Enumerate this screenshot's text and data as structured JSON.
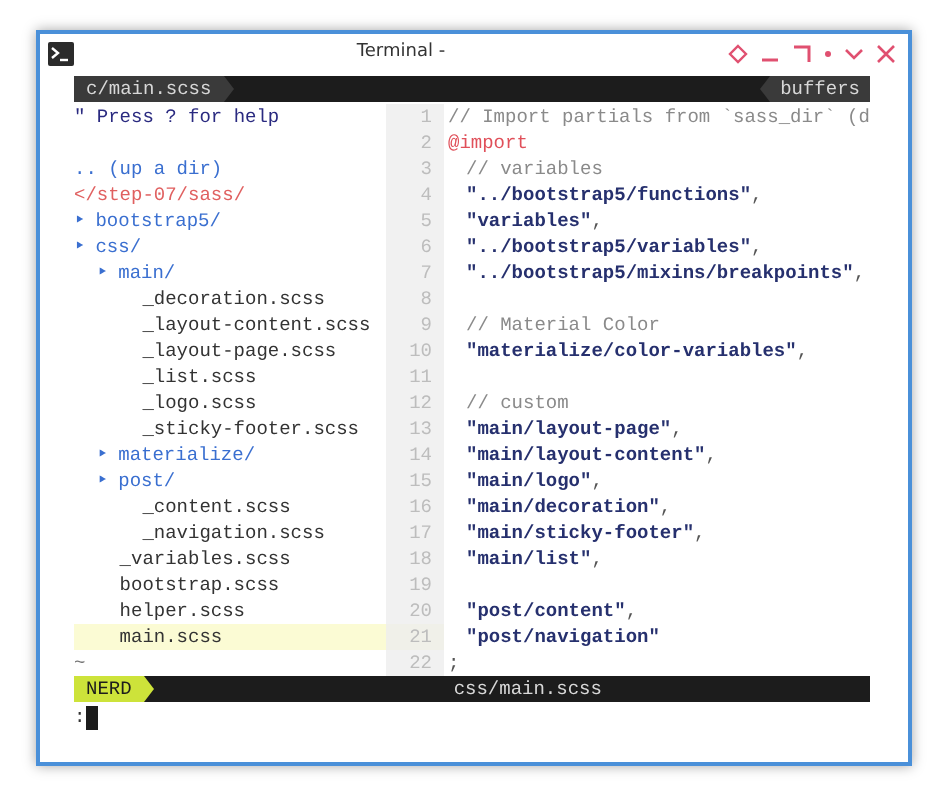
{
  "window": {
    "title": "Terminal -"
  },
  "tabline": {
    "buffer": "c/main.scss",
    "label": "buffers"
  },
  "tree": [
    {
      "kind": "help",
      "text": "\" Press ? for help"
    },
    {
      "kind": "blank"
    },
    {
      "kind": "updir",
      "text": ".. (up a dir)"
    },
    {
      "kind": "root",
      "text": "</step-07/sass/"
    },
    {
      "kind": "dir",
      "marker": "‣",
      "text": "bootstrap5/"
    },
    {
      "kind": "dir",
      "marker": "‣",
      "text": "css/",
      "children": [
        {
          "kind": "dir",
          "marker": "‣",
          "text": "main/",
          "children": [
            {
              "kind": "file",
              "text": "_decoration.scss",
              "selected": false
            },
            {
              "kind": "file",
              "text": "_layout-content.scss",
              "selected": false
            },
            {
              "kind": "file",
              "text": "_layout-page.scss",
              "selected": false
            },
            {
              "kind": "file",
              "text": "_list.scss",
              "selected": false
            },
            {
              "kind": "file",
              "text": "_logo.scss",
              "selected": false
            },
            {
              "kind": "file",
              "text": "_sticky-footer.scss",
              "selected": false
            }
          ]
        },
        {
          "kind": "dir",
          "marker": "‣",
          "text": "materialize/"
        },
        {
          "kind": "dir",
          "marker": "‣",
          "text": "post/",
          "children": [
            {
              "kind": "file",
              "text": "_content.scss",
              "selected": false
            },
            {
              "kind": "file",
              "text": "_navigation.scss",
              "selected": false
            }
          ]
        },
        {
          "kind": "file",
          "text": "_variables.scss",
          "selected": false
        },
        {
          "kind": "file",
          "text": "bootstrap.scss",
          "selected": false
        },
        {
          "kind": "file",
          "text": "helper.scss",
          "selected": false
        },
        {
          "kind": "file",
          "text": "main.scss",
          "selected": true
        }
      ]
    },
    {
      "kind": "end",
      "text": "~"
    }
  ],
  "code": [
    {
      "number": "1",
      "indented": false,
      "tokens": [
        {
          "kind": "comment",
          "text": "// Import partials from `sass_dir` (d"
        }
      ]
    },
    {
      "number": "2",
      "indented": false,
      "tokens": [
        {
          "kind": "keyword",
          "text": "@import"
        }
      ]
    },
    {
      "number": "3",
      "indented": true,
      "tokens": [
        {
          "kind": "comment",
          "text": "// variables"
        }
      ]
    },
    {
      "number": "4",
      "indented": true,
      "tokens": [
        {
          "kind": "string",
          "text": "\"../bootstrap5/functions\""
        },
        {
          "kind": "punct",
          "text": ","
        }
      ]
    },
    {
      "number": "5",
      "indented": true,
      "tokens": [
        {
          "kind": "string",
          "text": "\"variables\""
        },
        {
          "kind": "punct",
          "text": ","
        }
      ]
    },
    {
      "number": "6",
      "indented": true,
      "tokens": [
        {
          "kind": "string",
          "text": "\"../bootstrap5/variables\""
        },
        {
          "kind": "punct",
          "text": ","
        }
      ]
    },
    {
      "number": "7",
      "indented": true,
      "tokens": [
        {
          "kind": "string",
          "text": "\"../bootstrap5/mixins/breakpoints\""
        },
        {
          "kind": "punct",
          "text": ","
        }
      ]
    },
    {
      "number": "8",
      "indented": false
    },
    {
      "number": "9",
      "indented": true,
      "tokens": [
        {
          "kind": "comment",
          "text": "// Material Color"
        }
      ]
    },
    {
      "number": "10",
      "indented": true,
      "tokens": [
        {
          "kind": "string",
          "text": "\"materialize/color-variables\""
        },
        {
          "kind": "punct",
          "text": ","
        }
      ]
    },
    {
      "number": "11",
      "indented": false
    },
    {
      "number": "12",
      "indented": true,
      "tokens": [
        {
          "kind": "comment",
          "text": "// custom"
        }
      ]
    },
    {
      "number": "13",
      "indented": true,
      "tokens": [
        {
          "kind": "string",
          "text": "\"main/layout-page\""
        },
        {
          "kind": "punct",
          "text": ","
        }
      ]
    },
    {
      "number": "14",
      "indented": true,
      "tokens": [
        {
          "kind": "string",
          "text": "\"main/layout-content\""
        },
        {
          "kind": "punct",
          "text": ","
        }
      ]
    },
    {
      "number": "15",
      "indented": true,
      "tokens": [
        {
          "kind": "string",
          "text": "\"main/logo\""
        },
        {
          "kind": "punct",
          "text": ","
        }
      ]
    },
    {
      "number": "16",
      "indented": true,
      "tokens": [
        {
          "kind": "string",
          "text": "\"main/decoration\""
        },
        {
          "kind": "punct",
          "text": ","
        }
      ]
    },
    {
      "number": "17",
      "indented": true,
      "tokens": [
        {
          "kind": "string",
          "text": "\"main/sticky-footer\""
        },
        {
          "kind": "punct",
          "text": ","
        }
      ]
    },
    {
      "number": "18",
      "indented": true,
      "tokens": [
        {
          "kind": "string",
          "text": "\"main/list\""
        },
        {
          "kind": "punct",
          "text": ","
        }
      ]
    },
    {
      "number": "19",
      "indented": false
    },
    {
      "number": "20",
      "indented": true,
      "tokens": [
        {
          "kind": "string",
          "text": "\"post/content\""
        },
        {
          "kind": "punct",
          "text": ","
        }
      ]
    },
    {
      "number": "21",
      "indented": true,
      "tokens": [
        {
          "kind": "string",
          "text": "\"post/navigation\""
        }
      ]
    },
    {
      "number": "22",
      "indented": false,
      "tokens": [
        {
          "kind": "punct",
          "text": ";"
        }
      ]
    }
  ],
  "statusline": {
    "mode": "NERD",
    "file": "css/main.scss"
  },
  "cmdline": {
    "text": ":"
  }
}
